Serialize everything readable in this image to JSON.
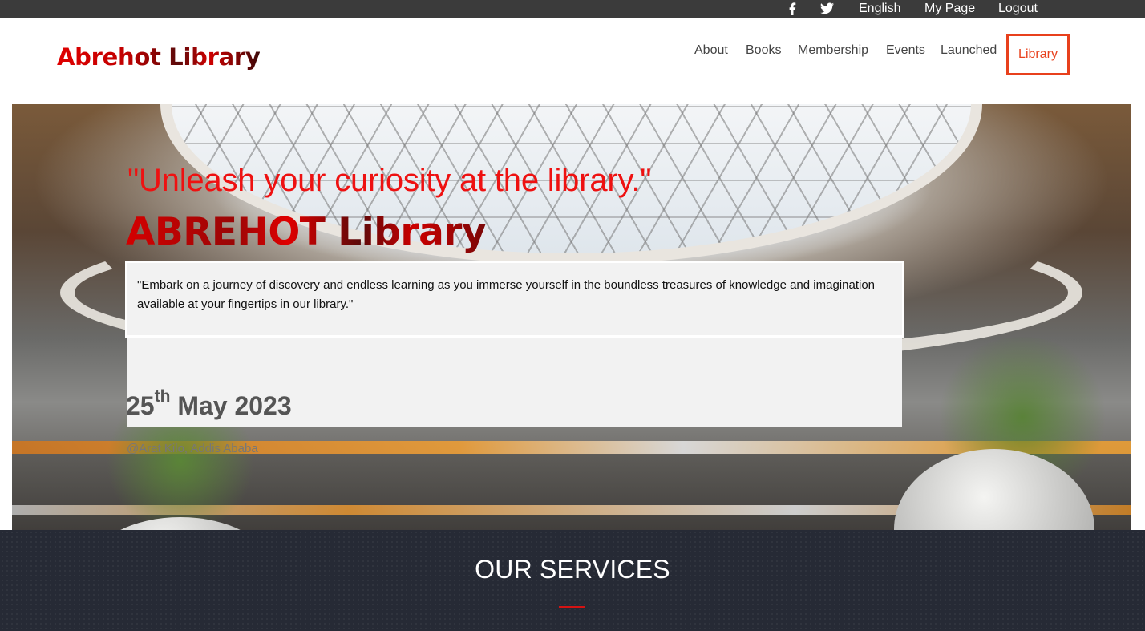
{
  "topbar": {
    "facebook_icon": "facebook-icon",
    "twitter_icon": "twitter-icon",
    "language": "English",
    "my_page": "My Page",
    "logout": "Logout"
  },
  "header": {
    "logo": "Abrehot Library",
    "nav": [
      "About",
      "Books",
      "Membership",
      "Events",
      "Launched",
      "Library"
    ],
    "active_nav": "Library",
    "active_color": "#e8401c"
  },
  "hero": {
    "quote": "\"Unleash your curiosity at the library.\"",
    "title": "ABREHOT Library",
    "intro": "\"Embark on a journey of discovery and endless learning as you immerse yourself in the boundless treasures of knowledge and imagination available at your fingertips in our library.\"",
    "date_day": "25",
    "date_suffix": "th",
    "date_rest": " May 2023",
    "location": "@Arat Kilo, Addis Ababa",
    "quote_color": "#ee1111"
  },
  "services": {
    "title": "OUR SERVICES",
    "accent_color": "#d41313",
    "background_color": "#262a35"
  }
}
